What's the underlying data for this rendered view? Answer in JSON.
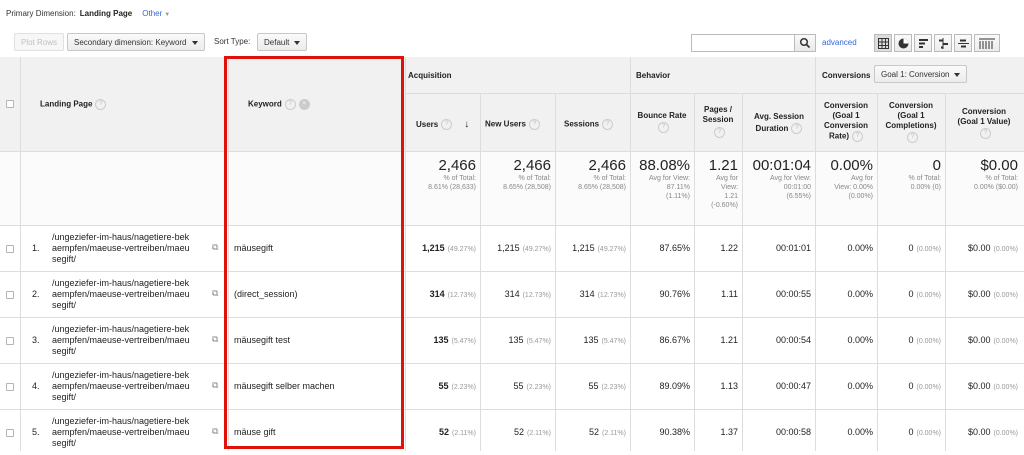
{
  "top": {
    "primary_label": "Primary Dimension:",
    "primary_value": "Landing Page",
    "other_label": "Other"
  },
  "toolbar": {
    "plot_rows": "Plot Rows",
    "secondary_dimension": "Secondary dimension: Keyword",
    "sort_type_label": "Sort Type:",
    "sort_type_value": "Default",
    "search_placeholder": "",
    "advanced": "advanced",
    "view_icons": [
      "table-view-icon",
      "pie-view-icon",
      "performance-view-icon",
      "comparison-view-icon",
      "term-cloud-view-icon",
      "pivot-view-icon"
    ]
  },
  "headers": {
    "landing_page": "Landing Page",
    "keyword": "Keyword",
    "acquisition": "Acquisition",
    "behavior": "Behavior",
    "conversions": "Conversions",
    "goal_select": "Goal 1: Conversion",
    "users": "Users",
    "new_users": "New Users",
    "sessions": "Sessions",
    "bounce_rate": "Bounce Rate",
    "pages_session_1": "Pages /",
    "pages_session_2": "Session",
    "avg_dur_1": "Avg. Session",
    "avg_dur_2": "Duration",
    "conv_rate_1": "Conversion",
    "conv_rate_2": "(Goal 1",
    "conv_rate_3": "Conversion",
    "conv_rate_4": "Rate)",
    "completions_1": "Conversion",
    "completions_2": "(Goal 1",
    "completions_3": "Completions)",
    "value_1": "Conversion",
    "value_2": "(Goal 1 Value)"
  },
  "totals": {
    "users": "2,466",
    "users_sub1": "% of Total:",
    "users_sub2": "8.61% (28,633)",
    "new_users": "2,466",
    "new_users_sub1": "% of Total:",
    "new_users_sub2": "8.65% (28,508)",
    "sessions": "2,466",
    "sessions_sub1": "% of Total:",
    "sessions_sub2": "8.65% (28,508)",
    "bounce": "88.08%",
    "bounce_sub1": "Avg for View:",
    "bounce_sub2": "87.11%",
    "bounce_sub3": "(1.11%)",
    "pages": "1.21",
    "pages_sub1": "Avg for",
    "pages_sub2": "View:",
    "pages_sub3": "1.21",
    "pages_sub4": "(-0.60%)",
    "duration": "00:01:04",
    "duration_sub1": "Avg for View:",
    "duration_sub2": "00:01:00",
    "duration_sub3": "(6.55%)",
    "conv_rate": "0.00%",
    "conv_rate_sub1": "Avg for",
    "conv_rate_sub2": "View: 0.00%",
    "conv_rate_sub3": "(0.00%)",
    "completions": "0",
    "completions_sub1": "% of Total:",
    "completions_sub2": "0.00% (0)",
    "value": "$0.00",
    "value_sub1": "% of Total:",
    "value_sub2": "0.00% ($0.00)"
  },
  "rows": [
    {
      "idx": "1.",
      "page": [
        "/ungeziefer-im-haus/nagetiere-bek",
        "aempfen/maeuse-vertreiben/maeu",
        "segift/"
      ],
      "keyword": "mäusegift",
      "users": "1,215",
      "users_pct": "(49.27%)",
      "new_users": "1,215",
      "new_users_pct": "(49.27%)",
      "sessions": "1,215",
      "sessions_pct": "(49.27%)",
      "bounce": "87.65%",
      "pages": "1.22",
      "duration": "00:01:01",
      "conv_rate": "0.00%",
      "completions": "0",
      "completions_pct": "(0.00%)",
      "value": "$0.00",
      "value_pct": "(0.00%)"
    },
    {
      "idx": "2.",
      "page": [
        "/ungeziefer-im-haus/nagetiere-bek",
        "aempfen/maeuse-vertreiben/maeu",
        "segift/"
      ],
      "keyword": "(direct_session)",
      "users": "314",
      "users_pct": "(12.73%)",
      "new_users": "314",
      "new_users_pct": "(12.73%)",
      "sessions": "314",
      "sessions_pct": "(12.73%)",
      "bounce": "90.76%",
      "pages": "1.11",
      "duration": "00:00:55",
      "conv_rate": "0.00%",
      "completions": "0",
      "completions_pct": "(0.00%)",
      "value": "$0.00",
      "value_pct": "(0.00%)"
    },
    {
      "idx": "3.",
      "page": [
        "/ungeziefer-im-haus/nagetiere-bek",
        "aempfen/maeuse-vertreiben/maeu",
        "segift/"
      ],
      "keyword": "mäusegift test",
      "users": "135",
      "users_pct": "(5.47%)",
      "new_users": "135",
      "new_users_pct": "(5.47%)",
      "sessions": "135",
      "sessions_pct": "(5.47%)",
      "bounce": "86.67%",
      "pages": "1.21",
      "duration": "00:00:54",
      "conv_rate": "0.00%",
      "completions": "0",
      "completions_pct": "(0.00%)",
      "value": "$0.00",
      "value_pct": "(0.00%)"
    },
    {
      "idx": "4.",
      "page": [
        "/ungeziefer-im-haus/nagetiere-bek",
        "aempfen/maeuse-vertreiben/maeu",
        "segift/"
      ],
      "keyword": "mäusegift selber machen",
      "users": "55",
      "users_pct": "(2.23%)",
      "new_users": "55",
      "new_users_pct": "(2.23%)",
      "sessions": "55",
      "sessions_pct": "(2.23%)",
      "bounce": "89.09%",
      "pages": "1.13",
      "duration": "00:00:47",
      "conv_rate": "0.00%",
      "completions": "0",
      "completions_pct": "(0.00%)",
      "value": "$0.00",
      "value_pct": "(0.00%)"
    },
    {
      "idx": "5.",
      "page": [
        "/ungeziefer-im-haus/nagetiere-bek",
        "aempfen/maeuse-vertreiben/maeu",
        "segift/"
      ],
      "keyword": "mäuse gift",
      "users": "52",
      "users_pct": "(2.11%)",
      "new_users": "52",
      "new_users_pct": "(2.11%)",
      "sessions": "52",
      "sessions_pct": "(2.11%)",
      "bounce": "90.38%",
      "pages": "1.37",
      "duration": "00:00:58",
      "conv_rate": "0.00%",
      "completions": "0",
      "completions_pct": "(0.00%)",
      "value": "$0.00",
      "value_pct": "(0.00%)"
    }
  ]
}
